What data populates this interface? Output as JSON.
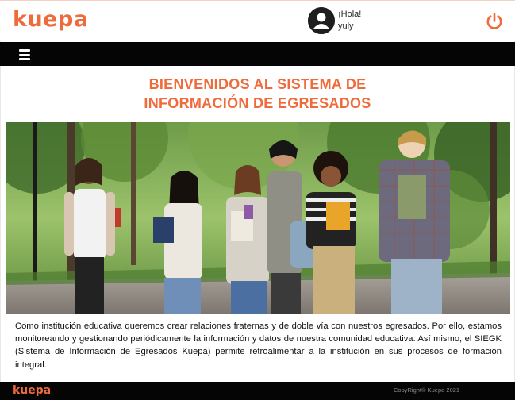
{
  "header": {
    "brand": "kuepa",
    "greeting": "¡Hola!",
    "user_name": "yuly"
  },
  "main": {
    "title_line1": "BIENVENIDOS AL SISTEMA DE",
    "title_line2": "INFORMACIÓN DE EGRESADOS",
    "description": "Como institución educativa queremos crear relaciones fraternas y de doble vía con nuestros egresados. Por ello, estamos monitoreando y gestionando periódicamente la información y datos de nuestra comunidad educativa. Así mismo, el SIEGK (Sistema de Información de Egresados Kuepa) permite retroalimentar a la institución en sus procesos de formación integral."
  },
  "footer": {
    "brand": "kuepa",
    "copyright": "CopyRight© Kuepa 2021"
  },
  "icons": {
    "avatar": "user-avatar-icon",
    "power": "power-icon",
    "menu": "hamburger-menu-icon"
  },
  "colors": {
    "brand_orange": "#ef6b3b",
    "bar_black": "#050505"
  }
}
